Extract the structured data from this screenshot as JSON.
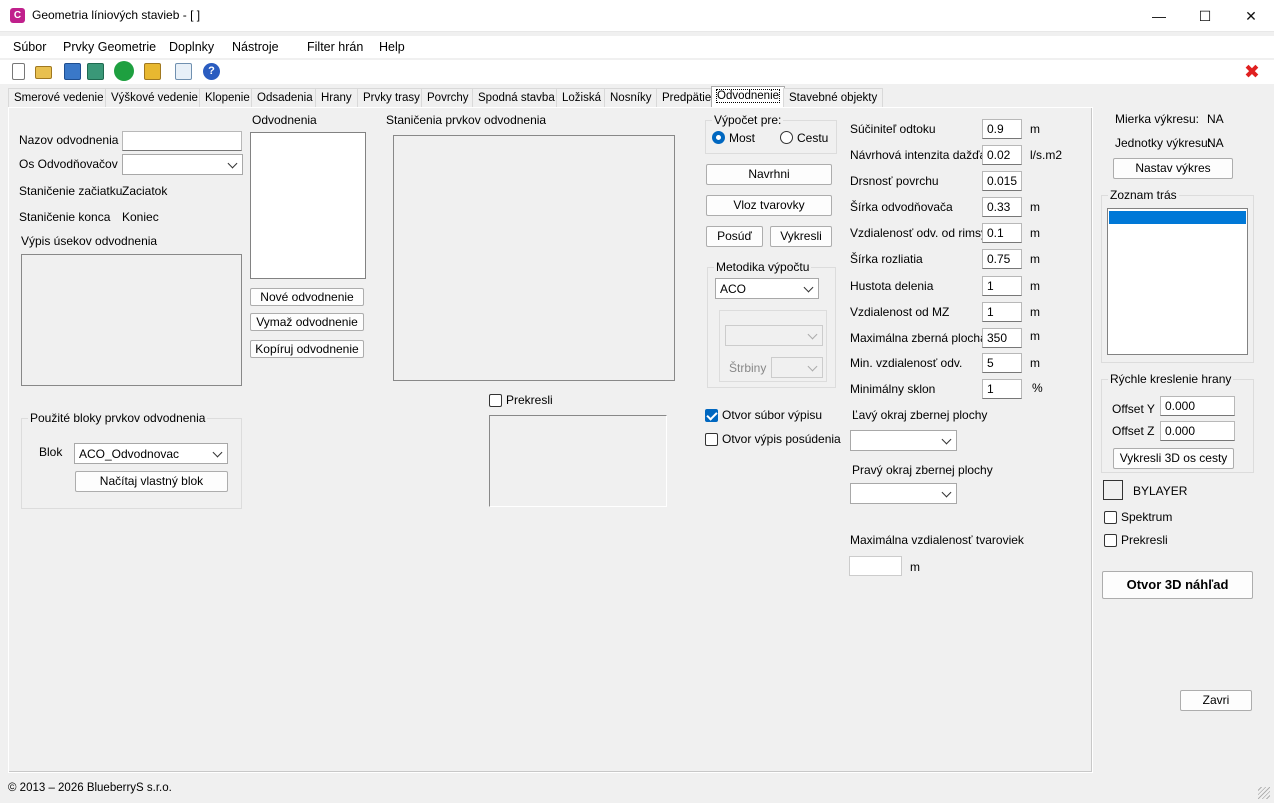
{
  "window": {
    "title": "Geometria líniových stavieb - [ ]",
    "app_icon": "C",
    "minimize": "—",
    "maximize": "☐",
    "close": "✕"
  },
  "menu": [
    "Súbor",
    "Prvky Geometrie",
    "Doplnky",
    "Nástroje",
    "Filter hrán",
    "Help"
  ],
  "toolbar": {
    "icons": [
      "new-file-icon",
      "open-folder-icon",
      "save-icon",
      "save-as-icon",
      "refresh-icon",
      "folder-settings-icon",
      "export-icon",
      "help-icon"
    ],
    "close_red": "✖"
  },
  "tabs": [
    "Smerové vedenie",
    "Výškové vedenie",
    "Klopenie",
    "Odsadenia",
    "Hrany",
    "Prvky trasy",
    "Povrchy",
    "Spodná stavba",
    "Ložiská",
    "Nosníky",
    "Predpätie",
    "Odvodnenie",
    "Stavebné objekty"
  ],
  "left": {
    "nazov_label": "Nazov odvodnenia",
    "nazov_value": "",
    "os_label": "Os Odvodňovačov",
    "zac_label": "Staničenie začiatku",
    "zac_value": "Zaciatok",
    "kon_label": "Staničenie konca",
    "kon_value": "Koniec",
    "vypis_label": "Výpis úsekov odvodnenia",
    "bloky_title": "Použité bloky prvkov odvodnenia",
    "blok_label": "Blok",
    "blok_value": "ACO_Odvodnovac",
    "nacitaj_btn": "Načítaj vlastný blok"
  },
  "odvodnenia": {
    "label": "Odvodnenia",
    "nove_btn": "Nové odvodnenie",
    "vymaz_btn": "Vymaž odvodnenie",
    "kopiruj_btn": "Kopíruj odvodnenie"
  },
  "stanicenia": {
    "label": "Staničenia prvkov odvodnenia",
    "prekresli": "Prekresli"
  },
  "vypocet": {
    "title": "Výpočet pre:",
    "most": "Most",
    "cestu": "Cestu",
    "navrhni": "Navrhni",
    "vloz": "Vloz tvarovky",
    "posud": "Posúď",
    "vykresli": "Vykresli",
    "metodika_title": "Metodika výpočtu",
    "metodika_value": "ACO",
    "strbiny": "Štrbiny",
    "otvor_subor": "Otvor súbor výpisu",
    "otvor_posudenia": "Otvor výpis posúdenia"
  },
  "params": [
    {
      "label": "Súčiniteľ odtoku",
      "value": "0.9",
      "unit": "m"
    },
    {
      "label": "Návrhová intenzita dažďa",
      "value": "0.02",
      "unit": "l/s.m2"
    },
    {
      "label": "Drsnosť povrchu",
      "value": "0.015",
      "unit": ""
    },
    {
      "label": "Šírka odvodňovača",
      "value": "0.33",
      "unit": "m"
    },
    {
      "label": "Vzdialenosť odv. od rimsy",
      "value": "0.1",
      "unit": "m"
    },
    {
      "label": "Šírka rozliatia",
      "value": "0.75",
      "unit": "m"
    },
    {
      "label": "Hustota delenia",
      "value": "1",
      "unit": "m"
    },
    {
      "label": "Vzdialenost od MZ",
      "value": "1",
      "unit": "m"
    },
    {
      "label": "Maximálna zberná plocha",
      "value": "350",
      "unit": "m"
    },
    {
      "label": "Min. vzdialenosť odv.",
      "value": "5",
      "unit": "m"
    },
    {
      "label": "Minimálny sklon",
      "value": "1",
      "unit": "%"
    }
  ],
  "okraje": {
    "lavy": "Ľavý okraj zbernej plochy",
    "pravy": "Pravý okraj zbernej plochy",
    "max_tvar": "Maximálna vzdialenosť tvaroviek",
    "max_unit": "m"
  },
  "right": {
    "mierka_label": "Mierka výkresu:",
    "mierka_value": "NA",
    "jednotky_label": "Jednotky výkresu:",
    "jednotky_value": "NA",
    "nastav_btn": "Nastav výkres",
    "zoznam_title": "Zoznam trás",
    "rychle_title": "Rýchle kreslenie hrany",
    "offy_label": "Offset Y",
    "offy_value": "0.000",
    "offz_label": "Offset Z",
    "offz_value": "0.000",
    "vykresli3d_btn": "Vykresli 3D os cesty",
    "bylayer": "BYLAYER",
    "spektrum": "Spektrum",
    "prekresli": "Prekresli",
    "otvor3d_btn": "Otvor 3D náhľad",
    "zavri_btn": "Zavri"
  },
  "status": "© 2013 – 2026 BlueberryS s.r.o."
}
